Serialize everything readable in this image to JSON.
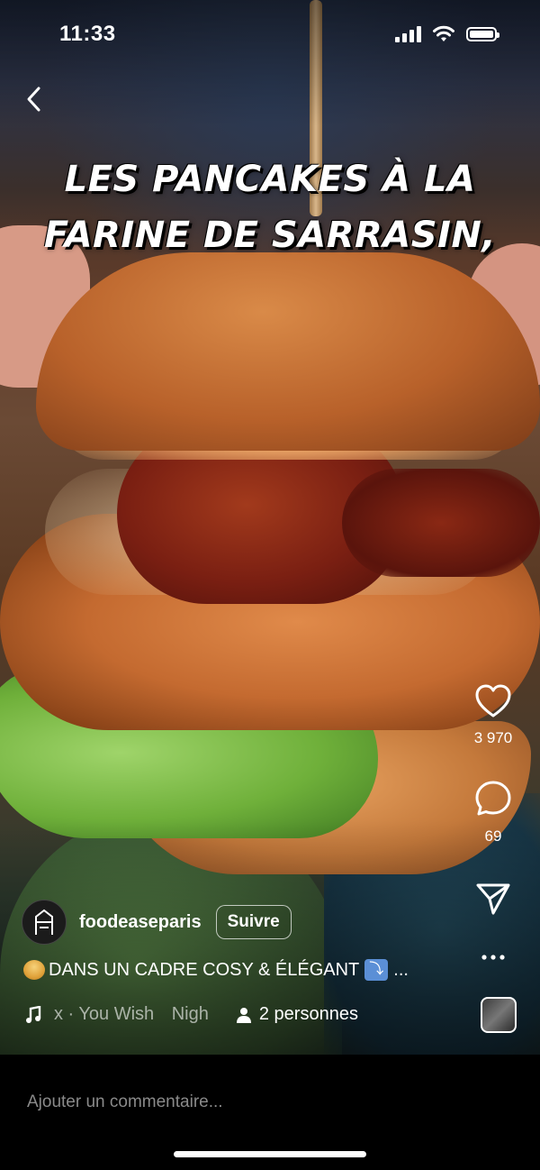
{
  "status_bar": {
    "time": "11:33"
  },
  "video": {
    "caption_line1": "LES PANCAKES À LA",
    "caption_line2": "FARINE DE SARRASIN,"
  },
  "actions": {
    "likes": "3 970",
    "comments": "69"
  },
  "author": {
    "username": "foodeaseparis",
    "follow_label": "Suivre"
  },
  "description": {
    "text": "DANS UN CADRE COSY & ÉLÉGANT",
    "more": "..."
  },
  "audio": {
    "track_prefix": "x · You Wish",
    "track_suffix": "Nigh",
    "people_label": "2 personnes"
  },
  "comment": {
    "placeholder": "Ajouter un commentaire..."
  },
  "icons": [
    "back-icon",
    "heart-icon",
    "comment-icon",
    "share-icon",
    "more-icon",
    "music-icon",
    "person-icon"
  ]
}
